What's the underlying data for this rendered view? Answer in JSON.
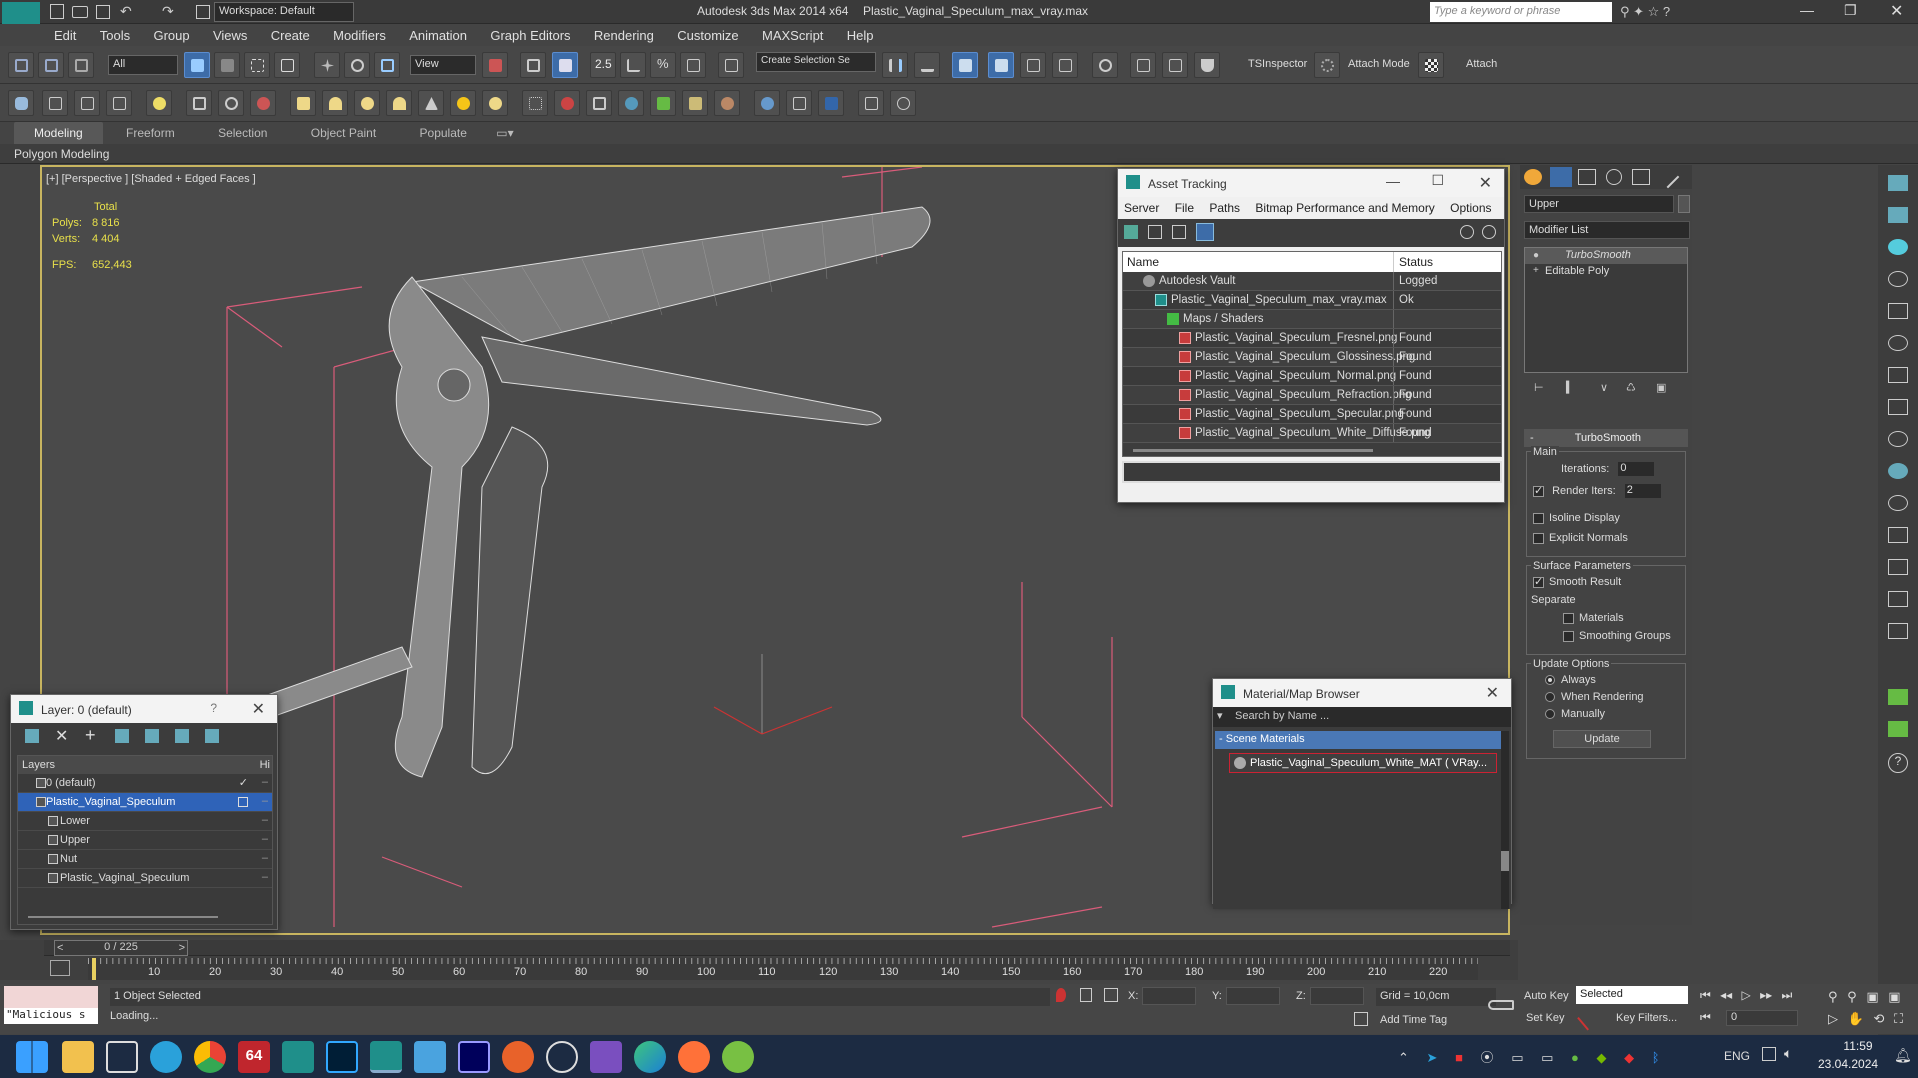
{
  "titlebar": {
    "workspace": "Workspace: Default",
    "app_title": "Autodesk 3ds Max  2014 x64",
    "file_title": "Plastic_Vaginal_Speculum_max_vray.max",
    "search_placeholder": "Type a keyword or phrase"
  },
  "menu": [
    "Edit",
    "Tools",
    "Group",
    "Views",
    "Create",
    "Modifiers",
    "Animation",
    "Graph Editors",
    "Rendering",
    "Customize",
    "MAXScript",
    "Help"
  ],
  "toolbar": {
    "filter_value": "All",
    "ref_coord": "View",
    "snap_value": "2.5",
    "selection_set": "Create Selection Se",
    "tsinspector": "TSInspector",
    "attach_mode": "Attach Mode",
    "attach": "Attach"
  },
  "ribbon": {
    "tabs": [
      "Modeling",
      "Freeform",
      "Selection",
      "Object Paint",
      "Populate"
    ],
    "active": "Modeling",
    "sub": "Polygon Modeling"
  },
  "viewport": {
    "label": "[+] [Perspective ] [Shaded + Edged Faces ]",
    "stats_total": "Total",
    "polys_label": "Polys:",
    "polys_value": "8 816",
    "verts_label": "Verts:",
    "verts_value": "4 404",
    "fps_label": "FPS:",
    "fps_value": "652,443"
  },
  "asset_tracking": {
    "title": "Asset Tracking",
    "menu": [
      "Server",
      "File",
      "Paths",
      "Bitmap Performance and Memory",
      "Options"
    ],
    "col_name": "Name",
    "col_status": "Status",
    "rows": [
      {
        "name": "Autodesk Vault",
        "status": "Logged",
        "indent": 2
      },
      {
        "name": "Plastic_Vaginal_Speculum_max_vray.max",
        "status": "Ok",
        "indent": 3
      },
      {
        "name": "Maps / Shaders",
        "status": "",
        "indent": 4
      },
      {
        "name": "Plastic_Vaginal_Speculum_Fresnel.png",
        "status": "Found",
        "indent": 5
      },
      {
        "name": "Plastic_Vaginal_Speculum_Glossiness.png",
        "status": "Found",
        "indent": 5
      },
      {
        "name": "Plastic_Vaginal_Speculum_Normal.png",
        "status": "Found",
        "indent": 5
      },
      {
        "name": "Plastic_Vaginal_Speculum_Refraction.png",
        "status": "Found",
        "indent": 5
      },
      {
        "name": "Plastic_Vaginal_Speculum_Specular.png",
        "status": "Found",
        "indent": 5
      },
      {
        "name": "Plastic_Vaginal_Speculum_White_Diffuse.png",
        "status": "Found",
        "indent": 5
      }
    ]
  },
  "material_browser": {
    "title": "Material/Map Browser",
    "search_placeholder": "Search by Name ...",
    "section": "Scene Materials",
    "material": "Plastic_Vaginal_Speculum_White_MAT  ( VRay..."
  },
  "layer_dialog": {
    "title": "Layer: 0 (default)",
    "col_layers": "Layers",
    "col_hide": "Hi",
    "rows": [
      {
        "name": "0 (default)",
        "indent": 1,
        "selected": false
      },
      {
        "name": "Plastic_Vaginal_Speculum",
        "indent": 1,
        "selected": true
      },
      {
        "name": "Lower",
        "indent": 2,
        "selected": false
      },
      {
        "name": "Upper",
        "indent": 2,
        "selected": false
      },
      {
        "name": "Nut",
        "indent": 2,
        "selected": false
      },
      {
        "name": "Plastic_Vaginal_Speculum",
        "indent": 2,
        "selected": false
      }
    ]
  },
  "command_panel": {
    "object_name": "Upper",
    "modifier_list": "Modifier List",
    "stack": [
      "TurboSmooth",
      "Editable Poly"
    ],
    "rollout_title": "TurboSmooth",
    "main_label": "Main",
    "iterations_label": "Iterations:",
    "iterations_value": "0",
    "render_iters_label": "Render Iters:",
    "render_iters_value": "2",
    "isoline": "Isoline Display",
    "explicit": "Explicit Normals",
    "surface_params": "Surface Parameters",
    "smooth_result": "Smooth Result",
    "separate": "Separate",
    "materials": "Materials",
    "smoothing_groups": "Smoothing Groups",
    "update_options": "Update Options",
    "always": "Always",
    "when_rendering": "When Rendering",
    "manually": "Manually",
    "update_btn": "Update"
  },
  "timeline": {
    "frame_counter": "0 / 225",
    "ticks": [
      "10",
      "20",
      "30",
      "40",
      "50",
      "60",
      "70",
      "80",
      "90",
      "100",
      "110",
      "120",
      "130",
      "140",
      "150",
      "160",
      "170",
      "180",
      "190",
      "200",
      "210",
      "220"
    ]
  },
  "status": {
    "selected": "1 Object Selected",
    "loading": "Loading...",
    "maxscript": "\"Malicious s",
    "x_label": "X:",
    "y_label": "Y:",
    "z_label": "Z:",
    "grid": "Grid = 10,0cm",
    "add_time_tag": "Add Time Tag",
    "auto_key": "Auto Key",
    "set_key": "Set Key",
    "selected_dd": "Selected",
    "key_filters": "Key Filters...",
    "frame": "0"
  },
  "taskbar": {
    "lang": "ENG",
    "time": "11:59",
    "date": "23.04.2024",
    "badge": "64"
  }
}
